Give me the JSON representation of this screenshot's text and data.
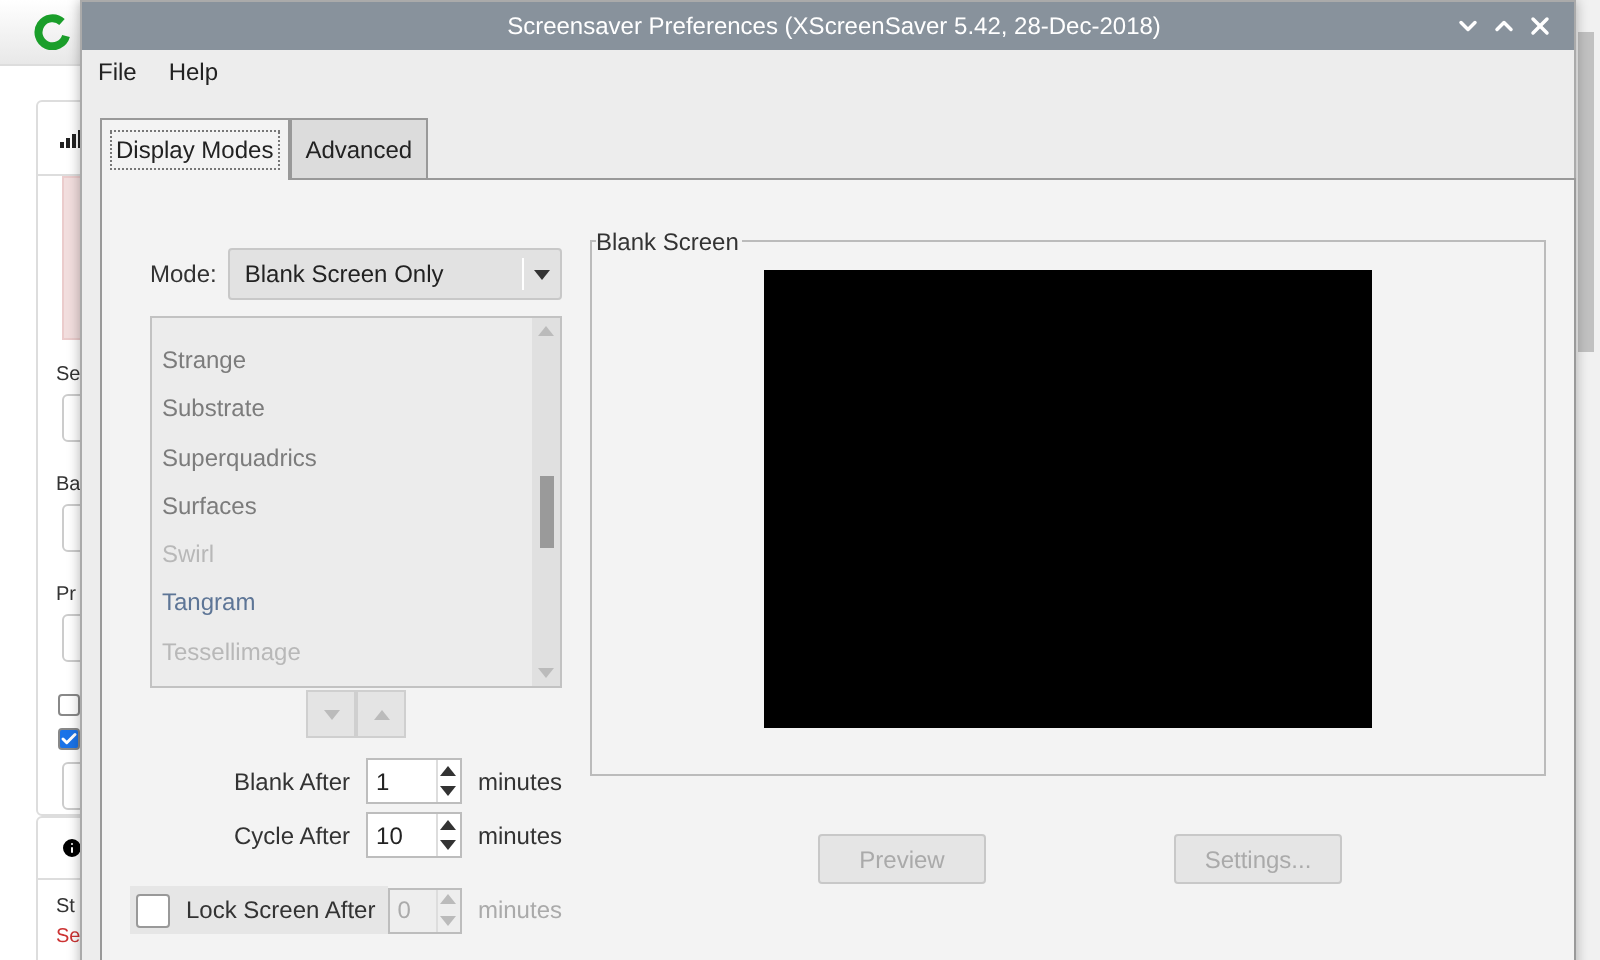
{
  "background_page": {
    "fields": [
      {
        "label": "Se"
      },
      {
        "label": "Ba"
      },
      {
        "label": "Pr"
      }
    ],
    "checkboxes": [
      {
        "checked": false
      },
      {
        "checked": true
      }
    ],
    "status": {
      "label": "St",
      "value": "Se"
    }
  },
  "window": {
    "title": "Screensaver Preferences  (XScreenSaver 5.42, 28-Dec-2018)"
  },
  "menu": [
    "File",
    "Help"
  ],
  "tabs": [
    {
      "label": "Display Modes",
      "selected": true
    },
    {
      "label": "Advanced",
      "selected": false
    }
  ],
  "mode": {
    "label": "Mode:",
    "value": "Blank Screen Only"
  },
  "modes": [
    {
      "name": "Strange",
      "disabled": false,
      "selected": false
    },
    {
      "name": "Substrate",
      "disabled": false,
      "selected": false
    },
    {
      "name": "Superquadrics",
      "disabled": false,
      "selected": false
    },
    {
      "name": "Surfaces",
      "disabled": false,
      "selected": false
    },
    {
      "name": "Swirl",
      "disabled": true,
      "selected": false
    },
    {
      "name": "Tangram",
      "disabled": false,
      "selected": true
    },
    {
      "name": "Tessellimage",
      "disabled": true,
      "selected": false
    }
  ],
  "timers": [
    {
      "label": "Blank After",
      "value": "1",
      "unit": "minutes"
    },
    {
      "label": "Cycle After",
      "value": "10",
      "unit": "minutes"
    }
  ],
  "lock": {
    "label": "Lock Screen After",
    "checked": false,
    "value": "0",
    "unit": "minutes",
    "disabled": true
  },
  "preview": {
    "title": "Blank Screen"
  },
  "buttons": [
    {
      "label": "Preview",
      "disabled": true
    },
    {
      "label": "Settings...",
      "disabled": true
    }
  ]
}
